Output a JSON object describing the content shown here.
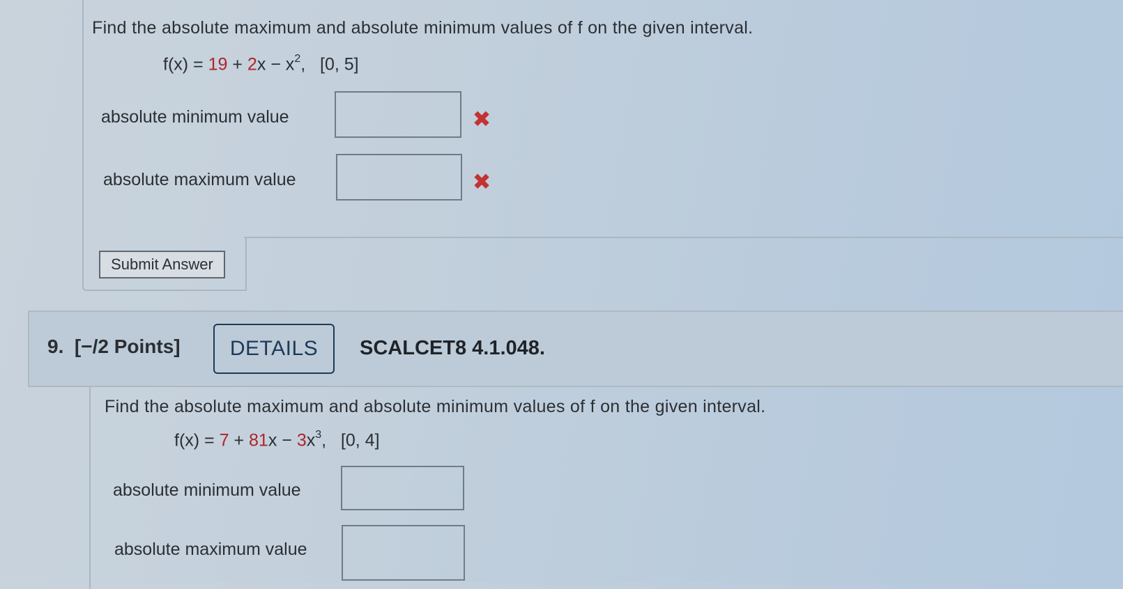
{
  "question8": {
    "prompt": "Find the absolute maximum and absolute minimum values of f on the given interval.",
    "formula": {
      "lhs": "f(x) = ",
      "c1": "19",
      "op1": " + ",
      "c2": "2",
      "t2": "x − x",
      "exp": "2",
      "tail": ",",
      "interval": "[0, 5]"
    },
    "min_label": "absolute minimum value",
    "min_value": "",
    "max_label": "absolute maximum value",
    "max_value": "",
    "incorrect_mark": "✖",
    "submit_label": "Submit Answer"
  },
  "question9": {
    "number": "9.",
    "points": "[−/2 Points]",
    "details_label": "DETAILS",
    "code": "SCALCET8 4.1.048.",
    "prompt": "Find the absolute maximum and absolute minimum values of f on the given interval.",
    "formula": {
      "lhs": "f(x) = ",
      "c1": "7",
      "op1": " + ",
      "c2": "81",
      "t2": "x − ",
      "c3": "3",
      "t3": "x",
      "exp": "3",
      "tail": ",",
      "interval": "[0, 4]"
    },
    "min_label": "absolute minimum value",
    "min_value": "",
    "max_label": "absolute maximum value",
    "max_value": ""
  },
  "colors": {
    "error": "#c43234",
    "coefficient": "#b0242a",
    "details_border": "#1e3a58"
  }
}
